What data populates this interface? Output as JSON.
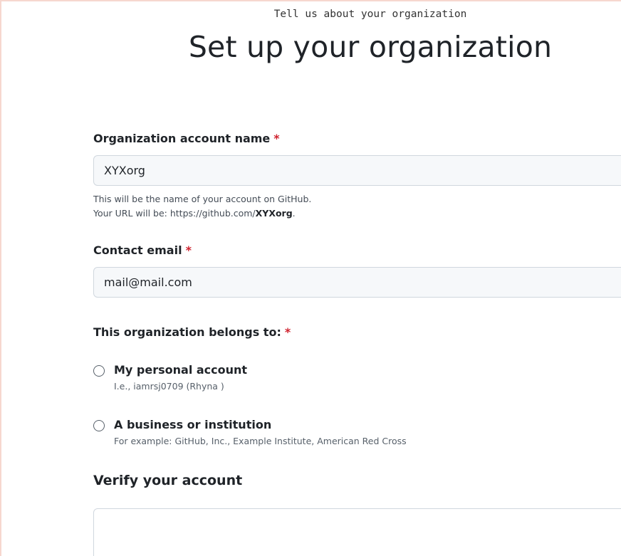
{
  "header": {
    "subtitle": "Tell us about your organization",
    "title": "Set up your organization"
  },
  "org_name": {
    "label": "Organization account name",
    "required_mark": "*",
    "value": "XYXorg",
    "help_line1": "This will be the name of your account on GitHub.",
    "help_url_prefix": "Your URL will be: https://github.com/",
    "help_url_name": "XYXorg",
    "help_url_suffix": "."
  },
  "contact_email": {
    "label": "Contact email",
    "required_mark": "*",
    "value": "mail@mail.com"
  },
  "belongs_to": {
    "label": "This organization belongs to:",
    "required_mark": "*",
    "options": [
      {
        "title": "My personal account",
        "description": "I.e., iamrsj0709 (Rhyna )"
      },
      {
        "title": "A business or institution",
        "description": "For example: GitHub, Inc., Example Institute, American Red Cross"
      }
    ]
  },
  "verify": {
    "title": "Verify your account"
  }
}
